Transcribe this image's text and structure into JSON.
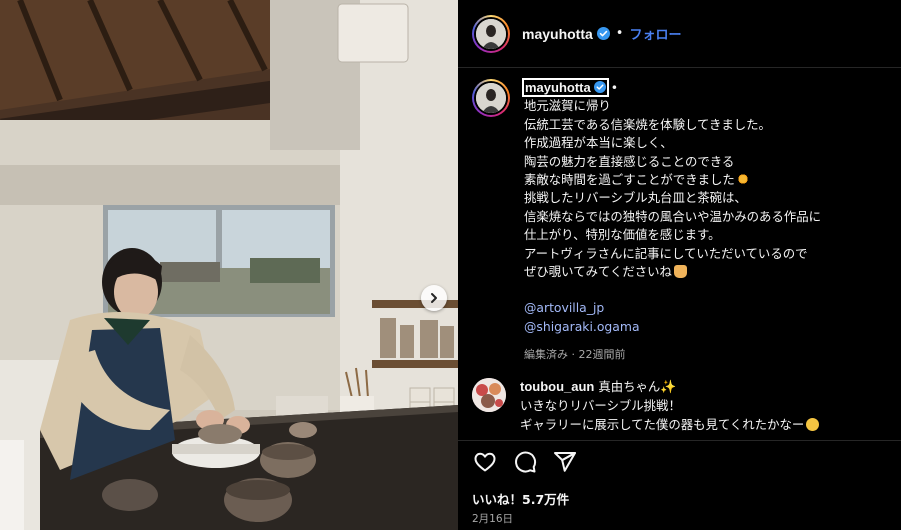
{
  "header": {
    "username": "mayuhotta",
    "separator": "•",
    "follow_label": "フォロー",
    "verified_icon": "verified-badge-icon"
  },
  "caption": {
    "username": "mayuhotta",
    "separator": "•",
    "lines": [
      "地元滋賀に帰り",
      "伝統工芸である信楽焼を体験してきました。",
      "作成過程が本当に楽しく、",
      "陶芸の魅力を直接感じることのできる",
      "素敵な時間を過ごすことができました",
      "挑戦したリバーシブル丸台皿と茶碗は、",
      "信楽焼ならではの独特の風合いや温かみのある作品に",
      "仕上がり、特別な価値を感じます。",
      "アートヴィラさんに記事にしていただいているので",
      "ぜひ覗いてみてくださいね"
    ],
    "mentions": [
      "@artovilla_jp",
      "@shigaraki.ogama"
    ],
    "meta": "編集済み · 22週間前"
  },
  "reply": {
    "username": "toubou_aun",
    "display": "真由ちゃん",
    "lines": [
      "いきなりリバーシブル挑戦！",
      "ギャラリーに展示してた僕の器も見てくれたかなー"
    ]
  },
  "actions": {
    "likes": "いいね！5.7万件",
    "date": "2月16日",
    "icons": [
      "heart-icon",
      "comment-icon",
      "share-icon"
    ]
  },
  "colors": {
    "background": "#000000",
    "link": "#4a80f2",
    "mention": "#a3b9f7",
    "muted": "#a8a8a8",
    "verified": "#3797f0"
  }
}
